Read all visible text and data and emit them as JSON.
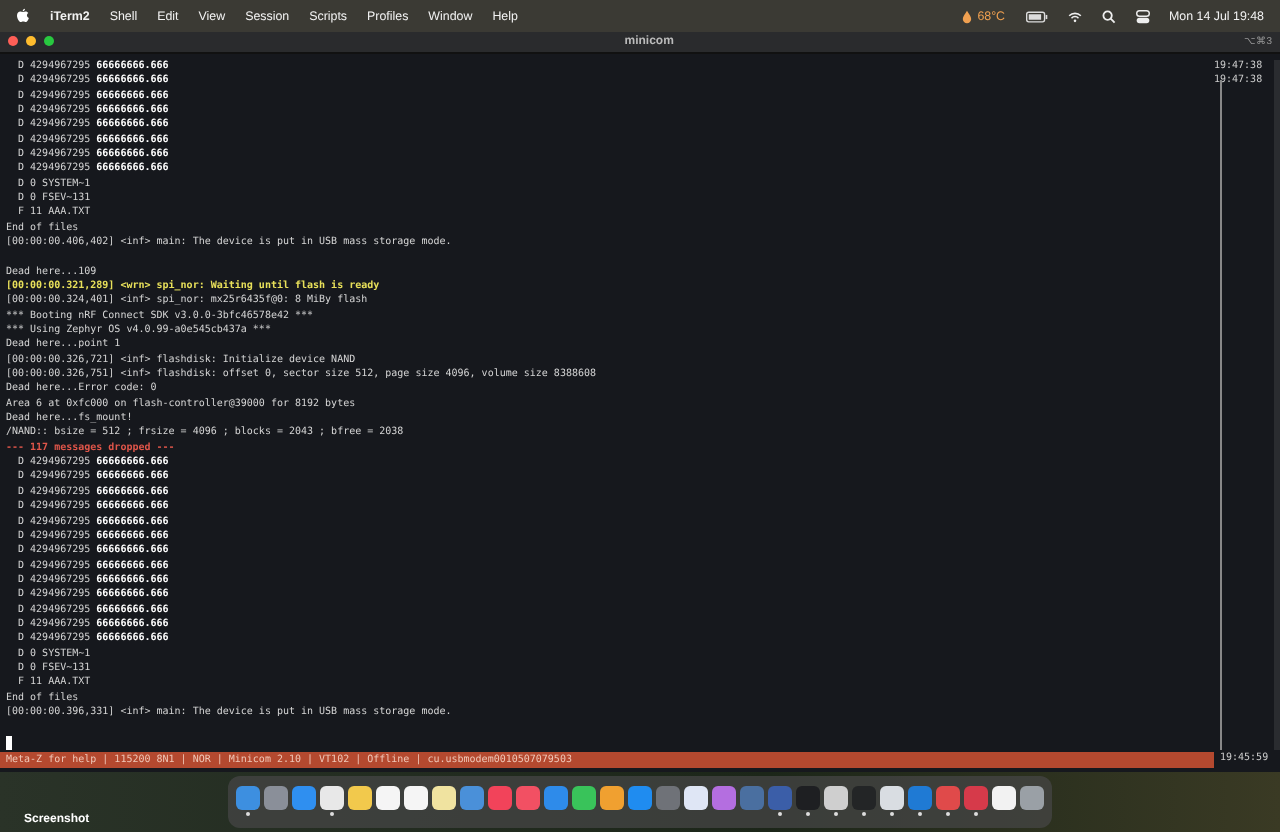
{
  "menu_bar": {
    "app": "iTerm2",
    "items": [
      "Shell",
      "Edit",
      "View",
      "Session",
      "Scripts",
      "Profiles",
      "Window",
      "Help"
    ],
    "temperature": "68°C",
    "clock": "Mon 14 Jul  19:48"
  },
  "window": {
    "title": "minicom",
    "shortcut": "⌥⌘3"
  },
  "terminal": {
    "lines": [
      {
        "kind": "normal",
        "text": "  D 4294967295 **66666666.666**"
      },
      {
        "kind": "normal",
        "text": "  D 4294967295 **66666666.666**"
      },
      {
        "kind": "normal",
        "text": "  D 4294967295 **66666666.666**"
      },
      {
        "kind": "normal",
        "text": "  D 4294967295 **66666666.666**"
      },
      {
        "kind": "normal",
        "text": "  D 4294967295 **66666666.666**"
      },
      {
        "kind": "normal",
        "text": "  D 4294967295 **66666666.666**"
      },
      {
        "kind": "normal",
        "text": "  D 4294967295 **66666666.666**"
      },
      {
        "kind": "normal",
        "text": "  D 4294967295 **66666666.666**"
      },
      {
        "kind": "normal",
        "text": "  D 0 SYSTEM~1"
      },
      {
        "kind": "normal",
        "text": "  D 0 FSEV~131"
      },
      {
        "kind": "normal",
        "text": "  F 11 AAA.TXT"
      },
      {
        "kind": "normal",
        "text": "End of files"
      },
      {
        "kind": "normal",
        "text": "[00:00:00.406,402] <inf> main: The device is put in USB mass storage mode."
      },
      {
        "kind": "blank"
      },
      {
        "kind": "normal",
        "text": "Dead here...109"
      },
      {
        "kind": "warning",
        "text": "[00:00:00.321,289] <wrn> spi_nor: Waiting until flash is ready"
      },
      {
        "kind": "normal",
        "text": "[00:00:00.324,401] <inf> spi_nor: mx25r6435f@0: 8 MiBy flash"
      },
      {
        "kind": "normal",
        "text": "*** Booting nRF Connect SDK v3.0.0-3bfc46578e42 ***"
      },
      {
        "kind": "normal",
        "text": "*** Using Zephyr OS v4.0.99-a0e545cb437a ***"
      },
      {
        "kind": "normal",
        "text": "Dead here...point 1"
      },
      {
        "kind": "normal",
        "text": "[00:00:00.326,721] <inf> flashdisk: Initialize device NAND"
      },
      {
        "kind": "normal",
        "text": "[00:00:00.326,751] <inf> flashdisk: offset 0, sector size 512, page size 4096, volume size 8388608"
      },
      {
        "kind": "normal",
        "text": "Dead here...Error code: 0"
      },
      {
        "kind": "normal",
        "text": "Area 6 at 0xfc000 on flash-controller@39000 for 8192 bytes"
      },
      {
        "kind": "normal",
        "text": "Dead here...fs_mount!"
      },
      {
        "kind": "normal",
        "text": "/NAND:: bsize = 512 ; frsize = 4096 ; blocks = 2043 ; bfree = 2038"
      },
      {
        "kind": "dropped",
        "text": "--- 117 messages dropped ---"
      },
      {
        "kind": "normal",
        "text": "  D 4294967295 **66666666.666**"
      },
      {
        "kind": "normal",
        "text": "  D 4294967295 **66666666.666**"
      },
      {
        "kind": "normal",
        "text": "  D 4294967295 **66666666.666**"
      },
      {
        "kind": "normal",
        "text": "  D 4294967295 **66666666.666**"
      },
      {
        "kind": "normal",
        "text": "  D 4294967295 **66666666.666**"
      },
      {
        "kind": "normal",
        "text": "  D 4294967295 **66666666.666**"
      },
      {
        "kind": "normal",
        "text": "  D 4294967295 **66666666.666**"
      },
      {
        "kind": "normal",
        "text": "  D 4294967295 **66666666.666**"
      },
      {
        "kind": "normal",
        "text": "  D 4294967295 **66666666.666**"
      },
      {
        "kind": "normal",
        "text": "  D 4294967295 **66666666.666**"
      },
      {
        "kind": "normal",
        "text": "  D 4294967295 **66666666.666**"
      },
      {
        "kind": "normal",
        "text": "  D 4294967295 **66666666.666**"
      },
      {
        "kind": "normal",
        "text": "  D 4294967295 **66666666.666**"
      },
      {
        "kind": "normal",
        "text": "  D 0 SYSTEM~1"
      },
      {
        "kind": "normal",
        "text": "  D 0 FSEV~131"
      },
      {
        "kind": "normal",
        "text": "  F 11 AAA.TXT"
      },
      {
        "kind": "normal",
        "text": "End of files"
      },
      {
        "kind": "normal",
        "text": "[00:00:00.396,331] <inf> main: The device is put in USB mass storage mode."
      },
      {
        "kind": "blank"
      },
      {
        "kind": "cursor"
      }
    ],
    "timestamps": [
      "19:47:38",
      "19:47:38"
    ],
    "status_bar": "Meta-Z for help | 115200 8N1 | NOR | Minicom 2.10 | VT102 | Offline | cu.usbmodem0010507079503",
    "status_time": "19:45:59"
  },
  "desktop": {
    "label": "Screenshot"
  },
  "dock": [
    {
      "color": "#3d8fe0",
      "running": true
    },
    {
      "color": "#8a8f99",
      "running": false
    },
    {
      "color": "#2f8ff0",
      "running": false
    },
    {
      "color": "#e8e8e8",
      "running": true
    },
    {
      "color": "#f2c94c",
      "running": false
    },
    {
      "color": "#f5f5f5",
      "running": false
    },
    {
      "color": "#f5f5f5",
      "running": false
    },
    {
      "color": "#f0e3a0",
      "running": false
    },
    {
      "color": "#4a90d9",
      "running": false
    },
    {
      "color": "#f2435a",
      "running": false
    },
    {
      "color": "#f25063",
      "running": false
    },
    {
      "color": "#2e8bea",
      "running": false
    },
    {
      "color": "#39c35a",
      "running": false
    },
    {
      "color": "#f0a030",
      "running": false
    },
    {
      "color": "#1f8cf0",
      "running": false
    },
    {
      "color": "#6f7278",
      "running": false
    },
    {
      "color": "#dfe6f5",
      "running": false
    },
    {
      "color": "#b46ee0",
      "running": false
    },
    {
      "color": "#4a6fa0",
      "running": false
    },
    {
      "color": "#3b5ea8",
      "running": true
    },
    {
      "color": "#1e1f22",
      "running": true
    },
    {
      "color": "#cfcfcf",
      "running": true
    },
    {
      "color": "#232526",
      "running": true
    },
    {
      "color": "#d9dde2",
      "running": true
    },
    {
      "color": "#1f7ad4",
      "running": true
    },
    {
      "color": "#e04a4a",
      "running": true
    },
    {
      "color": "#d63a4a",
      "running": true
    },
    {
      "color": "#f2f2f2",
      "running": false
    },
    {
      "color": "#9aa0a6",
      "running": false
    }
  ]
}
